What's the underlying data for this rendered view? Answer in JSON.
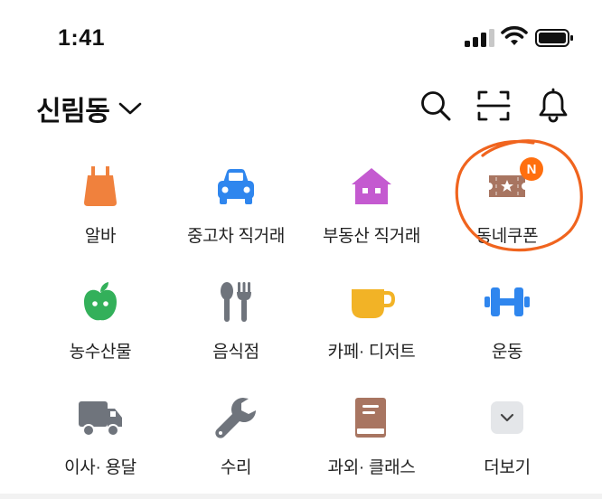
{
  "status": {
    "time": "1:41"
  },
  "header": {
    "location": "신림동"
  },
  "categories": [
    {
      "label": "알바",
      "icon": "apron-icon"
    },
    {
      "label": "중고차 직거래",
      "icon": "car-icon"
    },
    {
      "label": "부동산 직거래",
      "icon": "house-icon"
    },
    {
      "label": "동네쿠폰",
      "icon": "ticket-icon",
      "badge": "N"
    },
    {
      "label": "농수산물",
      "icon": "apple-icon"
    },
    {
      "label": "음식점",
      "icon": "utensils-icon"
    },
    {
      "label": "카페· 디저트",
      "icon": "cup-icon"
    },
    {
      "label": "운동",
      "icon": "dumbbell-icon"
    },
    {
      "label": "이사· 용달",
      "icon": "truck-icon"
    },
    {
      "label": "수리",
      "icon": "wrench-icon"
    },
    {
      "label": "과외· 클래스",
      "icon": "book-icon"
    },
    {
      "label": "더보기",
      "icon": "chevron-down-icon"
    }
  ],
  "colors": {
    "brand_orange": "#ff6f0f",
    "annotation": "#f0641e"
  }
}
